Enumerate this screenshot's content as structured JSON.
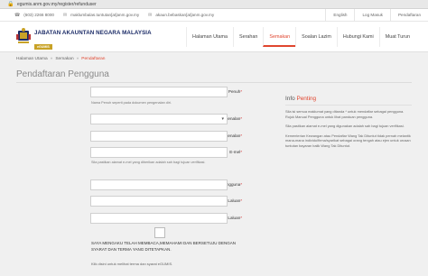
{
  "browser": {
    "url": "egumis.anm.gov.my/register/refunduser"
  },
  "topbar": {
    "phone": "(603) 2266 8000",
    "email1": "maklumbalas.tuntutan[at]anm.gov.my",
    "email2": "akaun.bebaskan[at]anm.gov.my",
    "lang": "English",
    "login": "Log Masuk",
    "register": "Pendaftaran"
  },
  "brand": {
    "name": "JABATAN AKAUNTAN NEGARA MALAYSIA",
    "sub": "eGUMIS"
  },
  "nav": {
    "items": [
      "Halaman Utama",
      "Serahan",
      "Semakan",
      "Soalan Lazim",
      "Hubungi Kami",
      "Muat Turun"
    ],
    "active_index": 2
  },
  "breadcrumb": {
    "home": "Halaman Utama",
    "level1": "Semakan",
    "current": "Pendaftaran",
    "sep": "»"
  },
  "page_title": "Pendaftaran Pengguna",
  "form": {
    "full_name_label": "Nama Penuh",
    "full_name_help": "Nama Penuh seperti pada dokumen pengenalan diri.",
    "id_type_label": "Jenis Pengenalan",
    "id_no_label": "No. Pengenalan",
    "email_label": "E-mel",
    "email_help": "Sila pastikan alamat e-mel yang diberikan adalah sah bagi tujuan verifikasi.",
    "username_label": "Nama Pengguna",
    "password_label": "Kata Laluan",
    "confirm_label": "Ulang Kata Laluan",
    "required_mark": "*",
    "agree_text": "SAYA MENGAKU TELAH MEMBACA,MEMAHAMI DAN BERSETUJU DENGAN SYARAT DAN TERMA YANG DITETAPKAN.",
    "terms_link_text": "Klik disini untuk melihat terma dan syarat eGUMIS."
  },
  "info": {
    "title_prefix": "Info ",
    "title_accent": "Penting",
    "p1": "Sila isi semua maklumat yang ditanda * untuk mendaftar sebagai pengguna. Rujuk Manual Pengguna untuk lihat panduan pengguna.",
    "p2": "Sila pastikan alamat e-mel yang digunakan adalah sah bagi tujuan verifikasi.",
    "p3": "Kementerian Kewangan atau Pendaftar Wang Tak Dituntut tidak pernah melantik mana-mana individu/firma/syarikat sebagai orang tengah atau ejen untuk urusan tuntutan bayaran balik Wang Tak Dituntut."
  },
  "colors": {
    "accent": "#e0452e",
    "brand": "#1a2a66",
    "gold": "#c8a227"
  }
}
